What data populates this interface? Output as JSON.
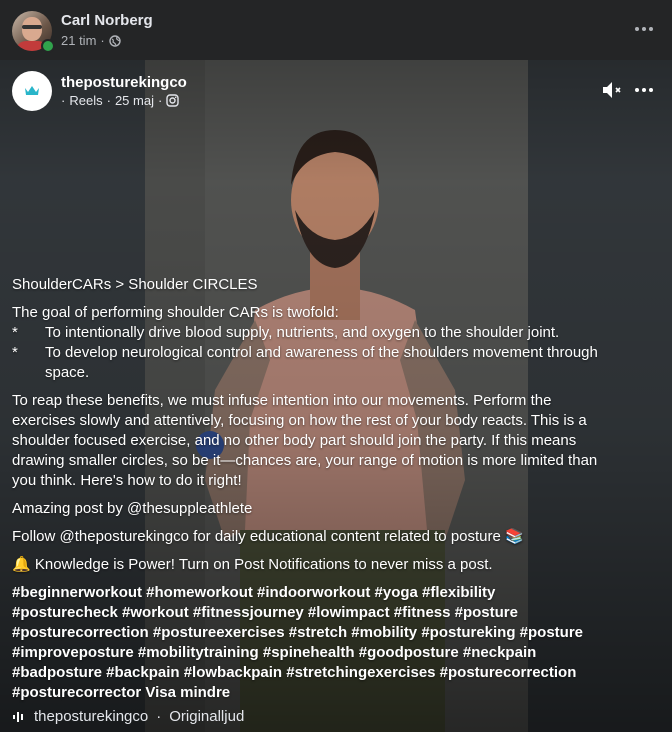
{
  "sharer": {
    "name": "Carl Norberg",
    "time": "21 tim",
    "separator": "·"
  },
  "reel": {
    "author_name": "theposturekingco",
    "meta_prefix": "·",
    "meta_type": "Reels",
    "meta_sep": "·",
    "meta_date": "25 maj",
    "meta_sep2": "·"
  },
  "caption": {
    "headline": "ShoulderCARs > Shoulder CIRCLES",
    "goal_intro": "The goal of performing shoulder CARs is twofold:",
    "bullet_mark": "*",
    "bullets": [
      "To intentionally drive blood supply, nutrients, and oxygen to the shoulder joint.",
      "To develop neurological control and awareness of the shoulders movement through space."
    ],
    "paragraph": "To reap these benefits, we must infuse intention into our movements. Perform the exercises slowly and attentively, focusing on how the rest of your body reacts. This is a shoulder focused exercise, and no other body part should join the party. If this means drawing smaller circles, so be it—chances are, your range of motion is more limited than you think. Here's how to do it right!",
    "credit": "Amazing post by @thesuppleathlete",
    "follow": "Follow @theposturekingco for daily educational content related to posture 📚",
    "notify": "🔔 Knowledge is Power! Turn on Post Notifications to never miss a post.",
    "hashtags": "#beginnerworkout #homeworkout #indoorworkout #yoga #flexibility #posturecheck #workout #fitnessjourney #lowimpact #fitness #posture #posturecorrection #postureexercises #stretch #mobility #postureking #posture #improveposture #mobilitytraining #spinehealth #goodposture #neckpain #badposture #backpain #lowbackpain #stretchingexercises #posturecorrection #posturecorrector",
    "see_less": "Visa mindre"
  },
  "audio": {
    "source": "theposturekingco",
    "separator": "·",
    "label": "Originalljud"
  },
  "icons": {
    "globe": "globe-icon",
    "instagram": "instagram-icon",
    "mute": "volume-muted-icon",
    "more": "more-icon",
    "audio": "audio-wave-icon",
    "crown": "crown-icon"
  },
  "colors": {
    "online": "#31a24c",
    "background": "#242526",
    "text": "#e4e6eb"
  }
}
